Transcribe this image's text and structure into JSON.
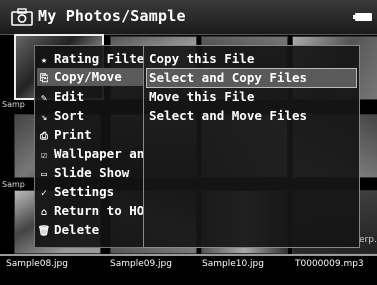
{
  "header": {
    "title": "My Photos/Sample",
    "left_icon": "camera-icon",
    "right_icon": "battery-icon"
  },
  "grid": {
    "row_labels": [
      "Samp",
      "Samp"
    ],
    "edge_label": "erp."
  },
  "files": [
    {
      "name": "Sample08.jpg"
    },
    {
      "name": "Sample09.jpg"
    },
    {
      "name": "Sample10.jpg"
    },
    {
      "name": "T0000009.mp3"
    }
  ],
  "menu": {
    "items": [
      {
        "label": "Rating Filter",
        "icon": "star-icon"
      },
      {
        "label": "Copy/Move",
        "icon": "copy-icon",
        "active": true
      },
      {
        "label": "Edit",
        "icon": "pencil-icon"
      },
      {
        "label": "Sort",
        "icon": "sort-icon"
      },
      {
        "label": "Print",
        "icon": "printer-icon"
      },
      {
        "label": "Wallpaper and",
        "icon": "wallpaper-icon"
      },
      {
        "label": "Slide Show",
        "icon": "slideshow-icon"
      },
      {
        "label": "Settings",
        "icon": "wrench-icon"
      },
      {
        "label": "Return to HOME",
        "icon": "home-icon"
      },
      {
        "label": "Delete",
        "icon": "trash-icon"
      }
    ]
  },
  "submenu": {
    "items": [
      {
        "label": "Copy this File"
      },
      {
        "label": "Select and Copy Files",
        "active": true
      },
      {
        "label": "Move this File"
      },
      {
        "label": "Select and Move Files"
      }
    ]
  },
  "colors": {
    "highlight": "#5a5a5a",
    "menu_bg": "#121212",
    "text": "#ffffff"
  }
}
